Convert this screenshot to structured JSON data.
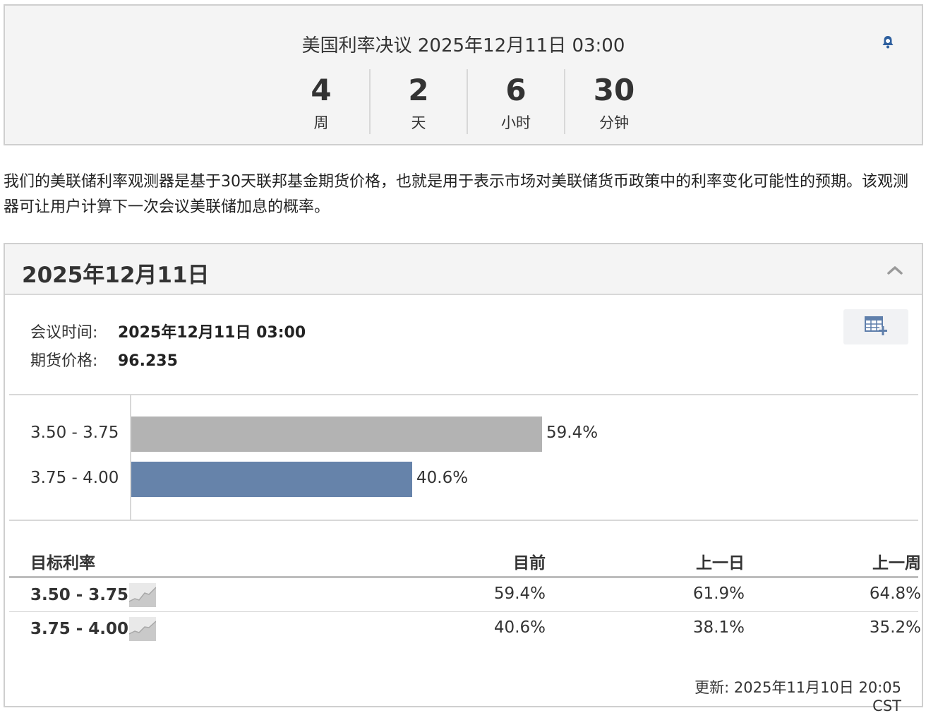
{
  "countdown": {
    "title": "美国利率决议 2025年12月11日 03:00",
    "units": [
      {
        "value": "4",
        "label": "周"
      },
      {
        "value": "2",
        "label": "天"
      },
      {
        "value": "6",
        "label": "小时"
      },
      {
        "value": "30",
        "label": "分钟"
      }
    ],
    "bell_icon": "bell-icon"
  },
  "description": "我们的美联储利率观测器是基于30天联邦基金期货价格，也就是用于表示市场对美联储货币政策中的利率变化可能性的预期。该观测器可让用户计算下一次会议美联储加息的概率。",
  "panel": {
    "title": "2025年12月11日",
    "meeting_time_label": "会议时间:",
    "meeting_time_value": "2025年12月11日 03:00",
    "futures_price_label": "期货价格:",
    "futures_price_value": "96.235",
    "export_icon": "table-add-icon",
    "collapse_icon": "chevron-up-icon"
  },
  "chart_data": {
    "type": "bar",
    "orientation": "horizontal",
    "categories": [
      "3.50 - 3.75",
      "3.75 - 4.00"
    ],
    "values": [
      59.4,
      40.6
    ],
    "value_labels": [
      "59.4%",
      "40.6%"
    ],
    "colors": [
      "#b3b3b3",
      "#6683aa"
    ],
    "xlim": [
      0,
      100
    ]
  },
  "table": {
    "headers": [
      "目标利率",
      "目前",
      "上一日",
      "上一周"
    ],
    "rows": [
      {
        "rate": "3.50 - 3.75",
        "current": "59.4%",
        "prev_day": "61.9%",
        "prev_week": "64.8%"
      },
      {
        "rate": "3.75 - 4.00",
        "current": "40.6%",
        "prev_day": "38.1%",
        "prev_week": "35.2%"
      }
    ]
  },
  "updated": "更新: 2025年11月10日 20:05 CST"
}
